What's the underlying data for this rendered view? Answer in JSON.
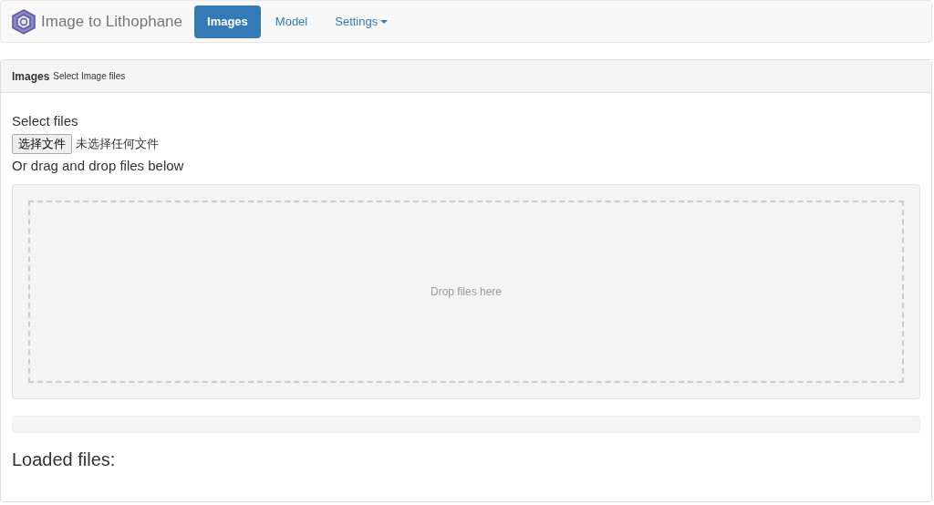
{
  "navbar": {
    "brand": "Image to Lithophane",
    "items": [
      {
        "label": "Images",
        "selected": true,
        "kind": "link"
      },
      {
        "label": "Model",
        "selected": false,
        "kind": "link"
      },
      {
        "label": "Settings",
        "selected": false,
        "kind": "dropdown"
      }
    ]
  },
  "panel": {
    "title": "Images",
    "subtitle": "Select Image files",
    "select_label": "Select files",
    "file_button": "选择文件",
    "file_status": "未选择任何文件",
    "drag_label": "Or drag and drop files below",
    "dropzone_text": "Drop files here",
    "progress": {
      "level": 0
    },
    "loaded_heading": "Loaded files:"
  }
}
